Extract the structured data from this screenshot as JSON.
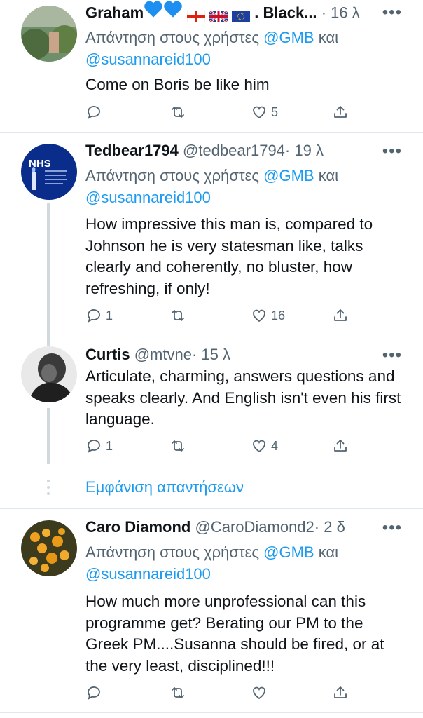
{
  "tweets": [
    {
      "name": "Graham",
      "name_suffix": ". Black...",
      "handle": "",
      "time": "· 16 λ",
      "reply_prefix": "Απάντηση στους χρήστες",
      "reply_user1": "@GMB",
      "reply_and": "και",
      "reply_user2": "@susannareid100",
      "text": "Come on Boris be like him",
      "replies": "",
      "retweets": "",
      "likes": "5"
    },
    {
      "name": "Tedbear1794",
      "handle": "@tedbear1794",
      "time": "· 19 λ",
      "reply_prefix": "Απάντηση στους χρήστες",
      "reply_user1": "@GMB",
      "reply_and": "και",
      "reply_user2": "@susannareid100",
      "text": "How impressive this man is, compared to Johnson he is very statesman like, talks clearly and coherently, no bluster, how refreshing, if only!",
      "replies": "1",
      "retweets": "",
      "likes": "16",
      "avatar_text": "NHS"
    },
    {
      "name": "Curtis",
      "handle": "@mtvne",
      "time": "· 15 λ",
      "text": "Articulate, charming, answers questions and speaks clearly. And English isn't even his first language.",
      "replies": "1",
      "retweets": "",
      "likes": "4"
    },
    {
      "name": "Caro Diamond",
      "handle": "@CaroDiamond2",
      "time": "· 2 δ",
      "reply_prefix": "Απάντηση στους χρήστες",
      "reply_user1": "@GMB",
      "reply_and": "και",
      "reply_user2": "@susannareid100",
      "text": "How much more unprofessional can this programme get? Berating our PM to the Greek PM....Susanna should be fired, or at the very least, disciplined!!!",
      "replies": "",
      "retweets": "",
      "likes": ""
    }
  ],
  "show_replies": "Εμφάνιση απαντήσεων",
  "more_glyph": "•••",
  "colors": {
    "link": "#1d9bf0",
    "muted": "#536471",
    "text": "#0f1419",
    "thread": "#cfd9de"
  }
}
